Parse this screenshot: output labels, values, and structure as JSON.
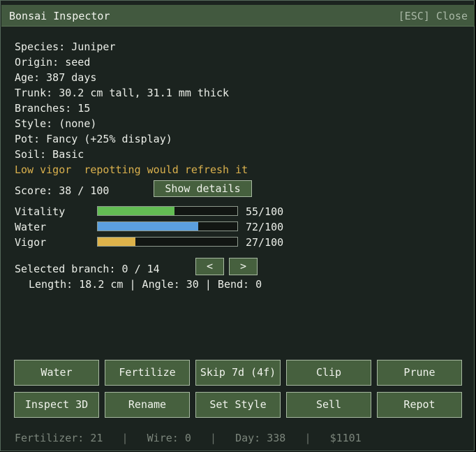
{
  "window": {
    "title": "Bonsai Inspector",
    "close_label": "[ESC] Close"
  },
  "info": {
    "species": "Species: Juniper",
    "origin": "Origin: seed",
    "age": "Age: 387 days",
    "trunk": "Trunk: 30.2 cm tall, 31.1 mm thick",
    "branches": "Branches: 15",
    "style": "Style: (none)",
    "pot": "Pot: Fancy (+25% display)",
    "soil": "Soil: Basic",
    "warning": "Low vigor  repotting would refresh it",
    "score": "Score: 38 / 100"
  },
  "show_details_label": "Show details",
  "stats": [
    {
      "label": "Vitality",
      "value": 55,
      "max": 100,
      "display": "55/100",
      "color": "#63bd54"
    },
    {
      "label": "Water",
      "value": 72,
      "max": 100,
      "display": "72/100",
      "color": "#5b9fdf"
    },
    {
      "label": "Vigor",
      "value": 27,
      "max": 100,
      "display": "27/100",
      "color": "#ddb24a"
    }
  ],
  "branch": {
    "selected": "Selected branch: 0 / 14",
    "prev_label": "<",
    "next_label": ">",
    "details": "Length: 18.2 cm | Angle: 30 | Bend: 0"
  },
  "actions": {
    "row1": [
      "Water",
      "Fertilize",
      "Skip 7d (4f)",
      "Clip",
      "Prune"
    ],
    "row2": [
      "Inspect 3D",
      "Rename",
      "Set Style",
      "Sell",
      "Repot"
    ]
  },
  "footer": {
    "fertilizer": "Fertilizer: 21",
    "wire": "Wire: 0",
    "day": "Day: 338",
    "money": "$1101",
    "separator": "|"
  }
}
